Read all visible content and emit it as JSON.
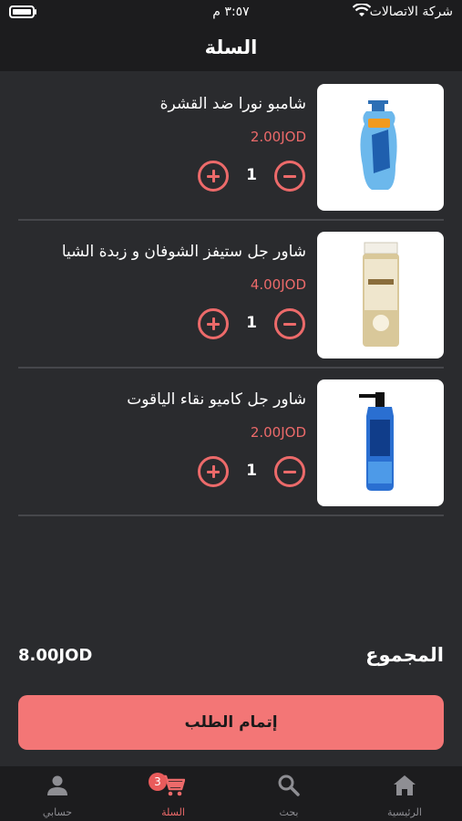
{
  "status_bar": {
    "carrier": "شركة الاتصالات",
    "time": "٣:٥٧ م"
  },
  "header": {
    "title": "السلة"
  },
  "items": [
    {
      "name": "شامبو نورا ضد القشرة",
      "price": "2.00JOD",
      "quantity": "1"
    },
    {
      "name": "شاور جل ستيفز الشوفان و زبدة الشيا",
      "price": "4.00JOD",
      "quantity": "1"
    },
    {
      "name": "شاور جل كاميو نقاء الياقوت",
      "price": "2.00JOD",
      "quantity": "1"
    }
  ],
  "summary": {
    "total_label": "المجموع",
    "total_value": "8.00JOD"
  },
  "checkout": {
    "label": "إتمام الطلب"
  },
  "tabbar": {
    "home": "الرئيسية",
    "search": "بحث",
    "cart": "السلة",
    "cart_badge": "3",
    "account": "حسابي"
  },
  "colors": {
    "accent": "#ec6a6a",
    "button": "#f37676",
    "background": "#2a2b2e",
    "bar": "#1c1c1e"
  }
}
